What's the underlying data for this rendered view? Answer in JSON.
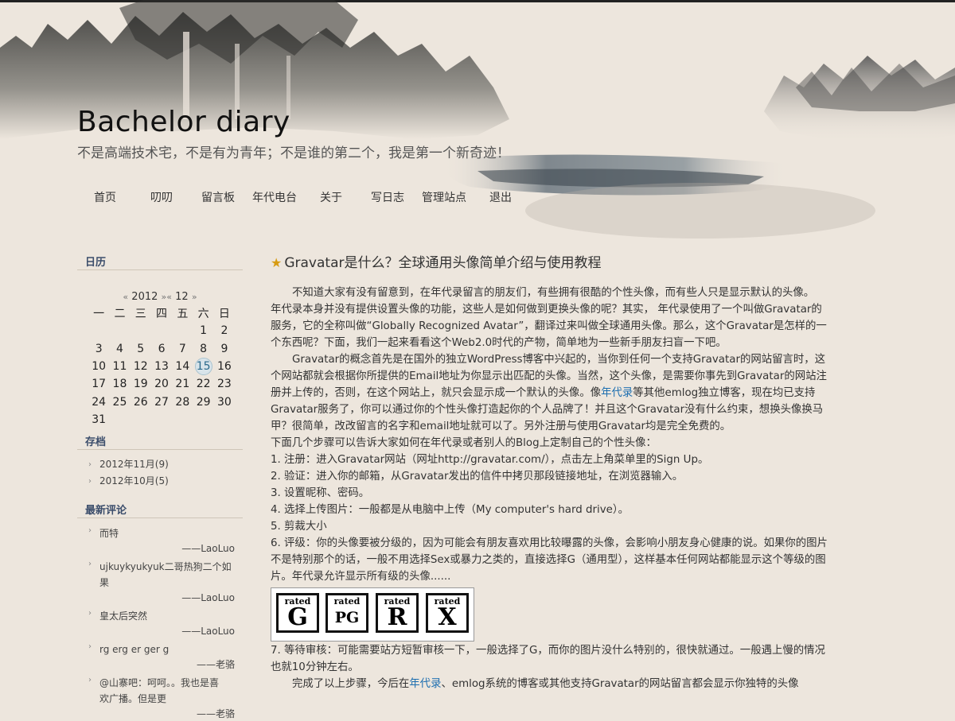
{
  "site": {
    "title": "Bachelor diary",
    "subtitle": "不是高端技术宅，不是有为青年；不是谁的第二个，我是第一个新奇迹！"
  },
  "nav": [
    "首页",
    "叨叨",
    "留言板",
    "年代电台",
    "关于",
    "写日志",
    "管理站点",
    "退出"
  ],
  "sidebar": {
    "calendar_title": "日历",
    "calendar": {
      "year": "2012",
      "month": "12",
      "prev_arrow": "«",
      "next_arrow": "»",
      "weekdays": [
        "一",
        "二",
        "三",
        "四",
        "五",
        "六",
        "日"
      ],
      "weeks": [
        [
          "",
          "",
          "",
          "",
          "",
          "1",
          "2"
        ],
        [
          "3",
          "4",
          "5",
          "6",
          "7",
          "8",
          "9"
        ],
        [
          "10",
          "11",
          "12",
          "13",
          "14",
          "15",
          "16"
        ],
        [
          "17",
          "18",
          "19",
          "20",
          "21",
          "22",
          "23"
        ],
        [
          "24",
          "25",
          "26",
          "27",
          "28",
          "29",
          "30"
        ],
        [
          "31",
          "",
          "",
          "",
          "",
          "",
          ""
        ]
      ],
      "today": "15"
    },
    "archive_title": "存档",
    "archives": [
      "2012年11月(9)",
      "2012年10月(5)"
    ],
    "comments_title": "最新评论",
    "comments": [
      {
        "text": "而特",
        "author": "——LaoLuo"
      },
      {
        "text": "ujkuykyukyuk二哥热狗二个如果",
        "author": "——LaoLuo"
      },
      {
        "text": "皇太后突然",
        "author": "——LaoLuo"
      },
      {
        "text": "rg erg er ger g",
        "author": "——老骆"
      },
      {
        "text": "@山寨吧：呵呵。。我也是喜欢广播。但是更",
        "author": "——老骆"
      }
    ]
  },
  "post": {
    "title": "Gravatar是什么？全球通用头像简单介绍与使用教程",
    "p1": "不知道大家有没有留意到，在年代录留言的朋友们，有些拥有很酷的个性头像，而有些人只是显示默认的头像。 年代录本身并没有提供设置头像的功能，这些人是如何做到更换头像的呢？其实， 年代录使用了一个叫做Gravatar的服务，它的全称叫做“Globally Recognized Avatar”，翻译过来叫做全球通用头像。那么，这个Gravatar是怎样的一个东西呢？下面，我们一起来看看这个Web2.0时代的产物，简单地为一些新手朋友扫盲一下吧。",
    "p2a": "Gravatar的概念首先是在国外的独立WordPress博客中兴起的，当你到任何一个支持Gravatar的网站留言时，这个网站都就会根据你所提供的Email地址为你显示出匹配的头像。当然，这个头像，是需要你事先到Gravatar的网站注册并上传的，否则，在这个网站上，就只会显示成一个默认的头像。像",
    "link1": "年代录",
    "p2b": "等其他emlog独立博客，现在均已支持Gravatar服务了，你可以通过你的个性头像打造起你的个人品牌了！并且这个Gravatar没有什么约束，想换头像换马甲？很简单，改改留言的名字和email地址就可以了。另外注册与使用Gravatar均是完全免费的。",
    "steps_intro": "下面几个步骤可以告诉大家如何在年代录或者别人的Blog上定制自己的个性头像：",
    "steps": [
      "1. 注册：进入Gravatar网站（网址http://gravatar.com/），点击左上角菜单里的Sign Up。",
      "2. 验证：进入你的邮箱，从Gravatar发出的信件中拷贝那段链接地址，在浏览器输入。",
      "3. 设置昵称、密码。",
      "4. 选择上传图片：一般都是从电脑中上传（My computer's hard drive）。",
      "5. 剪裁大小",
      "6. 评级：你的头像要被分级的，因为可能会有朋友喜欢用比较曝露的头像，会影响小朋友身心健康的说。如果你的图片不是特别那个的话，一般不用选择Sex或暴力之类的，直接选择G（通用型），这样基本任何网站都能显示这个等级的图片。年代录允许显示所有级的头像......"
    ],
    "ratings": [
      {
        "rated": "rated",
        "code": "G"
      },
      {
        "rated": "rated",
        "code": "PG"
      },
      {
        "rated": "rated",
        "code": "R"
      },
      {
        "rated": "rated",
        "code": "X"
      }
    ],
    "step7": "7. 等待审核：可能需要站方短暂审核一下，一般选择了G，而你的图片没什么特别的，很快就通过。一般遇上慢的情况也就10分钟左右。",
    "p_last_a": "完成了以上步骤，今后在",
    "link2": "年代录",
    "p_last_b": "、emlog系统的博客或其他支持Gravatar的网站留言都会显示你独特的头像"
  }
}
